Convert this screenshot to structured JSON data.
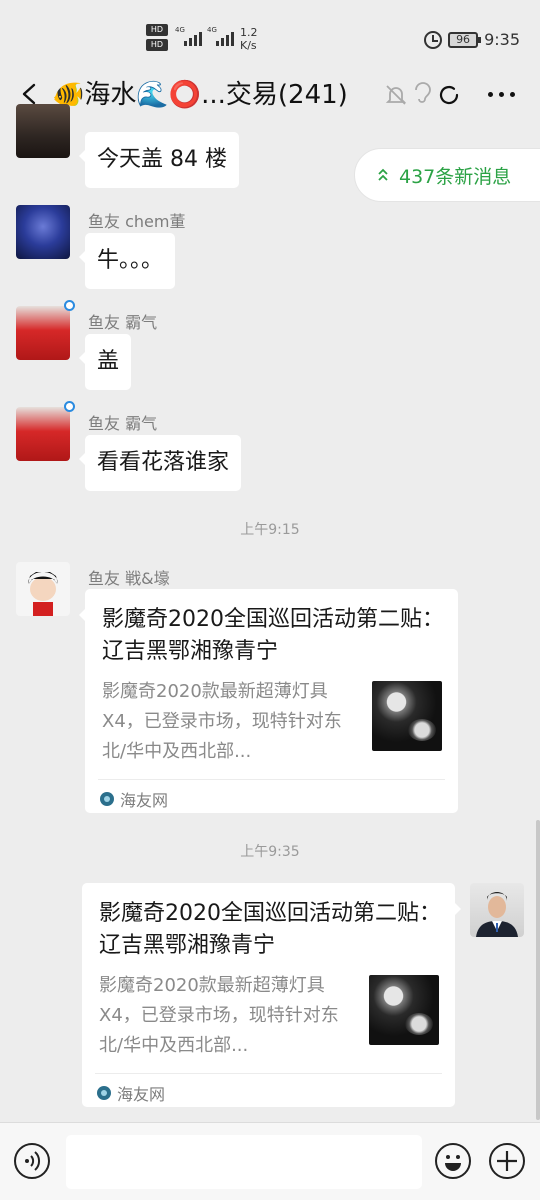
{
  "status_bar": {
    "hd1": "HD",
    "hd2": "HD",
    "net1": "4G",
    "net2": "4G",
    "speed_value": "1.2",
    "speed_unit": "K/s",
    "battery": "96",
    "time": "9:35"
  },
  "header": {
    "title": "🐠海水🌊⭕...交易(241)"
  },
  "new_messages": {
    "label": "437条新消息"
  },
  "messages": {
    "m1": {
      "text": "今天盖 84 楼"
    },
    "m2": {
      "sender": "鱼友 chem董",
      "text": "牛。。。"
    },
    "m3": {
      "sender": "鱼友 霸气",
      "text": "盖"
    },
    "m4": {
      "sender": "鱼友 霸气",
      "text": "看看花落谁家"
    },
    "time1": "上午9:15",
    "m5": {
      "sender": "鱼友 戦&壕",
      "title": "影魔奇2020全国巡回活动第二贴： 辽吉黑鄂湘豫青宁",
      "desc": "影魔奇2020款最新超薄灯具X4，已登录市场，现特针对东北/华中及西北部...",
      "source": "海友网"
    },
    "time2": "上午9:35",
    "m6": {
      "title": "影魔奇2020全国巡回活动第二贴： 辽吉黑鄂湘豫青宁",
      "desc": "影魔奇2020款最新超薄灯具X4，已登录市场，现特针对东北/华中及西北部...",
      "source": "海友网"
    }
  },
  "input_bar": {
    "placeholder": ""
  },
  "colors": {
    "accent_green": "#2ba245",
    "background": "#ededed"
  }
}
